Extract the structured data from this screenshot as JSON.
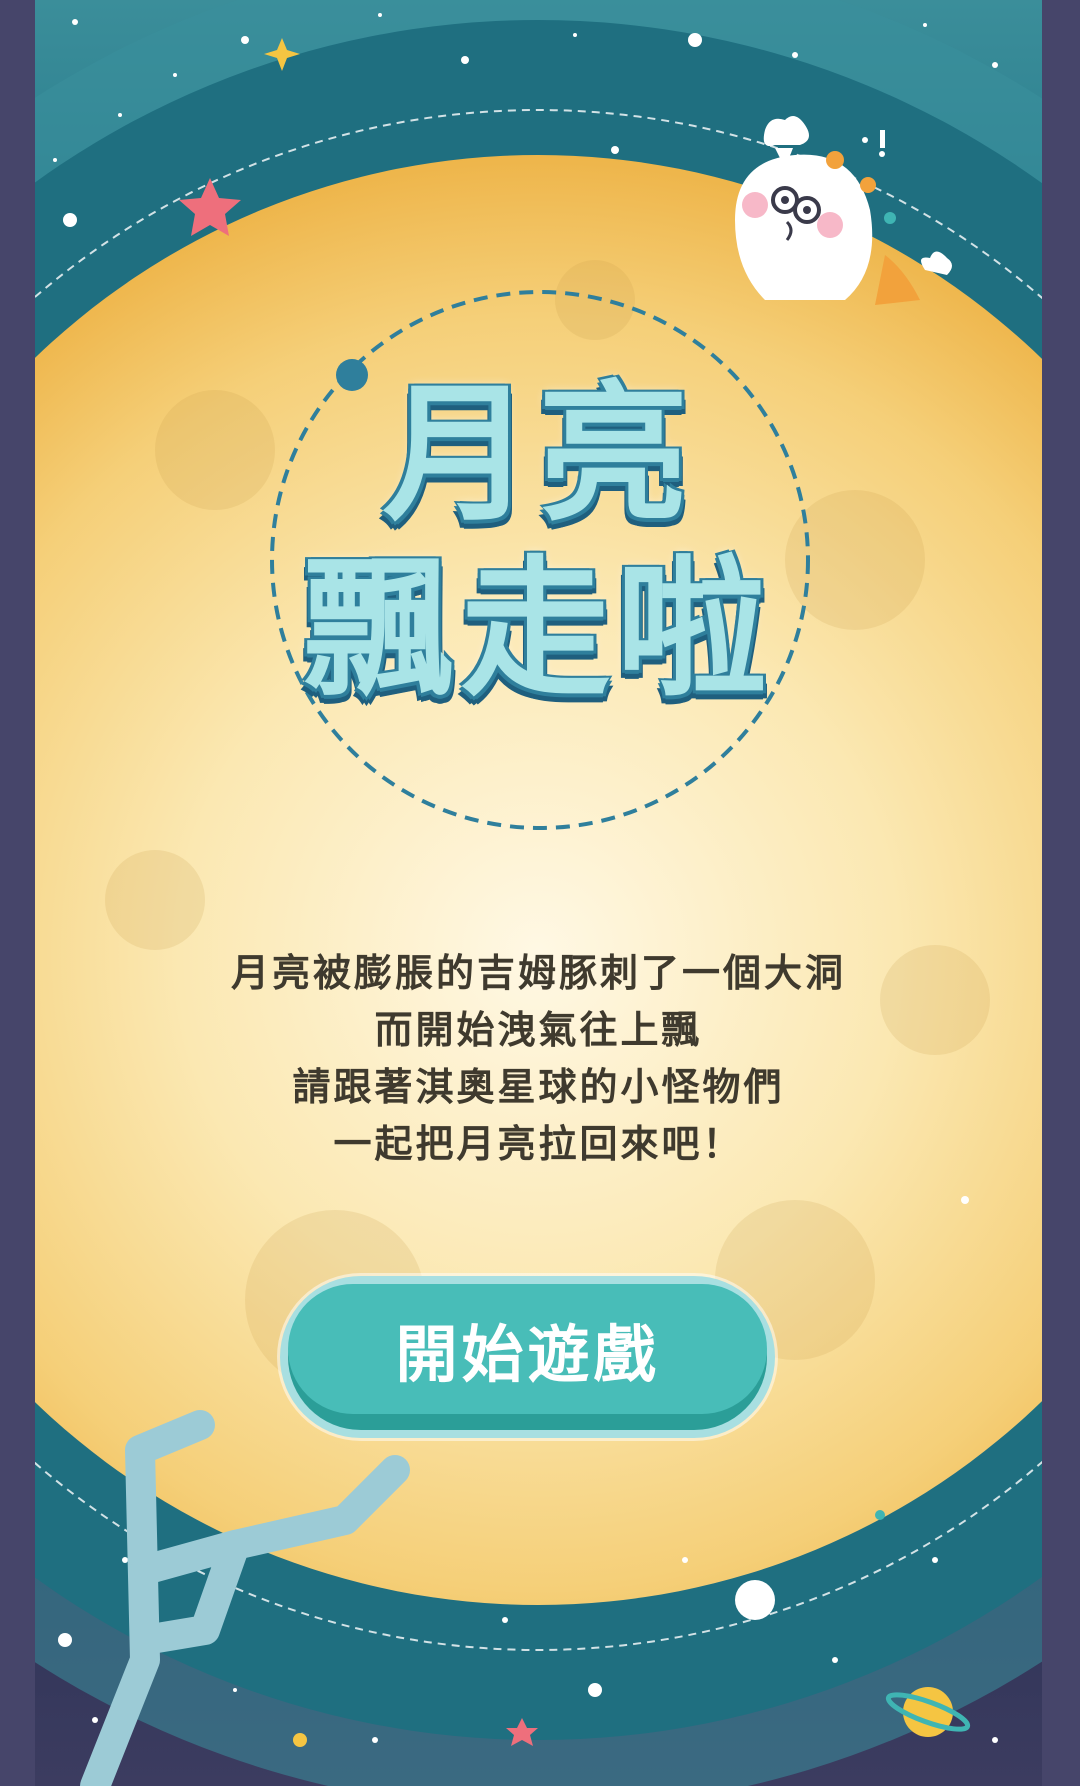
{
  "title": {
    "line1": "月亮",
    "line2": "飄走啦"
  },
  "description": {
    "lines": [
      "月亮被膨脹的吉姆豚刺了一個大洞",
      "而開始洩氣往上飄",
      "請跟著淇奧星球的小怪物們",
      "一起把月亮拉回來吧！"
    ]
  },
  "start_button": {
    "label": "開始遊戲"
  },
  "icons": {
    "character": "white-ghost-monster-icon",
    "planet": "planet-icon",
    "stars": "star-icon",
    "constellation": "constellation-icon"
  },
  "colors": {
    "moon": "#f6d27e",
    "title_fill": "#a9e4e7",
    "title_outline": "#2f7f9c",
    "button": "#48bdb8",
    "sky_top": "#2b7e8e",
    "sky_bottom": "#3c3c60"
  }
}
